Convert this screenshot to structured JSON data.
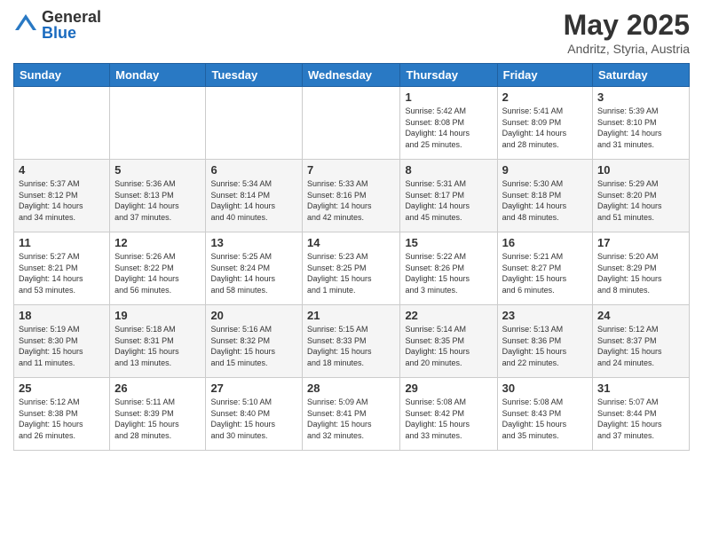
{
  "logo": {
    "general": "General",
    "blue": "Blue"
  },
  "title": {
    "month": "May 2025",
    "location": "Andritz, Styria, Austria"
  },
  "headers": [
    "Sunday",
    "Monday",
    "Tuesday",
    "Wednesday",
    "Thursday",
    "Friday",
    "Saturday"
  ],
  "weeks": [
    [
      {
        "day": "",
        "info": ""
      },
      {
        "day": "",
        "info": ""
      },
      {
        "day": "",
        "info": ""
      },
      {
        "day": "",
        "info": ""
      },
      {
        "day": "1",
        "info": "Sunrise: 5:42 AM\nSunset: 8:08 PM\nDaylight: 14 hours\nand 25 minutes."
      },
      {
        "day": "2",
        "info": "Sunrise: 5:41 AM\nSunset: 8:09 PM\nDaylight: 14 hours\nand 28 minutes."
      },
      {
        "day": "3",
        "info": "Sunrise: 5:39 AM\nSunset: 8:10 PM\nDaylight: 14 hours\nand 31 minutes."
      }
    ],
    [
      {
        "day": "4",
        "info": "Sunrise: 5:37 AM\nSunset: 8:12 PM\nDaylight: 14 hours\nand 34 minutes."
      },
      {
        "day": "5",
        "info": "Sunrise: 5:36 AM\nSunset: 8:13 PM\nDaylight: 14 hours\nand 37 minutes."
      },
      {
        "day": "6",
        "info": "Sunrise: 5:34 AM\nSunset: 8:14 PM\nDaylight: 14 hours\nand 40 minutes."
      },
      {
        "day": "7",
        "info": "Sunrise: 5:33 AM\nSunset: 8:16 PM\nDaylight: 14 hours\nand 42 minutes."
      },
      {
        "day": "8",
        "info": "Sunrise: 5:31 AM\nSunset: 8:17 PM\nDaylight: 14 hours\nand 45 minutes."
      },
      {
        "day": "9",
        "info": "Sunrise: 5:30 AM\nSunset: 8:18 PM\nDaylight: 14 hours\nand 48 minutes."
      },
      {
        "day": "10",
        "info": "Sunrise: 5:29 AM\nSunset: 8:20 PM\nDaylight: 14 hours\nand 51 minutes."
      }
    ],
    [
      {
        "day": "11",
        "info": "Sunrise: 5:27 AM\nSunset: 8:21 PM\nDaylight: 14 hours\nand 53 minutes."
      },
      {
        "day": "12",
        "info": "Sunrise: 5:26 AM\nSunset: 8:22 PM\nDaylight: 14 hours\nand 56 minutes."
      },
      {
        "day": "13",
        "info": "Sunrise: 5:25 AM\nSunset: 8:24 PM\nDaylight: 14 hours\nand 58 minutes."
      },
      {
        "day": "14",
        "info": "Sunrise: 5:23 AM\nSunset: 8:25 PM\nDaylight: 15 hours\nand 1 minute."
      },
      {
        "day": "15",
        "info": "Sunrise: 5:22 AM\nSunset: 8:26 PM\nDaylight: 15 hours\nand 3 minutes."
      },
      {
        "day": "16",
        "info": "Sunrise: 5:21 AM\nSunset: 8:27 PM\nDaylight: 15 hours\nand 6 minutes."
      },
      {
        "day": "17",
        "info": "Sunrise: 5:20 AM\nSunset: 8:29 PM\nDaylight: 15 hours\nand 8 minutes."
      }
    ],
    [
      {
        "day": "18",
        "info": "Sunrise: 5:19 AM\nSunset: 8:30 PM\nDaylight: 15 hours\nand 11 minutes."
      },
      {
        "day": "19",
        "info": "Sunrise: 5:18 AM\nSunset: 8:31 PM\nDaylight: 15 hours\nand 13 minutes."
      },
      {
        "day": "20",
        "info": "Sunrise: 5:16 AM\nSunset: 8:32 PM\nDaylight: 15 hours\nand 15 minutes."
      },
      {
        "day": "21",
        "info": "Sunrise: 5:15 AM\nSunset: 8:33 PM\nDaylight: 15 hours\nand 18 minutes."
      },
      {
        "day": "22",
        "info": "Sunrise: 5:14 AM\nSunset: 8:35 PM\nDaylight: 15 hours\nand 20 minutes."
      },
      {
        "day": "23",
        "info": "Sunrise: 5:13 AM\nSunset: 8:36 PM\nDaylight: 15 hours\nand 22 minutes."
      },
      {
        "day": "24",
        "info": "Sunrise: 5:12 AM\nSunset: 8:37 PM\nDaylight: 15 hours\nand 24 minutes."
      }
    ],
    [
      {
        "day": "25",
        "info": "Sunrise: 5:12 AM\nSunset: 8:38 PM\nDaylight: 15 hours\nand 26 minutes."
      },
      {
        "day": "26",
        "info": "Sunrise: 5:11 AM\nSunset: 8:39 PM\nDaylight: 15 hours\nand 28 minutes."
      },
      {
        "day": "27",
        "info": "Sunrise: 5:10 AM\nSunset: 8:40 PM\nDaylight: 15 hours\nand 30 minutes."
      },
      {
        "day": "28",
        "info": "Sunrise: 5:09 AM\nSunset: 8:41 PM\nDaylight: 15 hours\nand 32 minutes."
      },
      {
        "day": "29",
        "info": "Sunrise: 5:08 AM\nSunset: 8:42 PM\nDaylight: 15 hours\nand 33 minutes."
      },
      {
        "day": "30",
        "info": "Sunrise: 5:08 AM\nSunset: 8:43 PM\nDaylight: 15 hours\nand 35 minutes."
      },
      {
        "day": "31",
        "info": "Sunrise: 5:07 AM\nSunset: 8:44 PM\nDaylight: 15 hours\nand 37 minutes."
      }
    ]
  ]
}
